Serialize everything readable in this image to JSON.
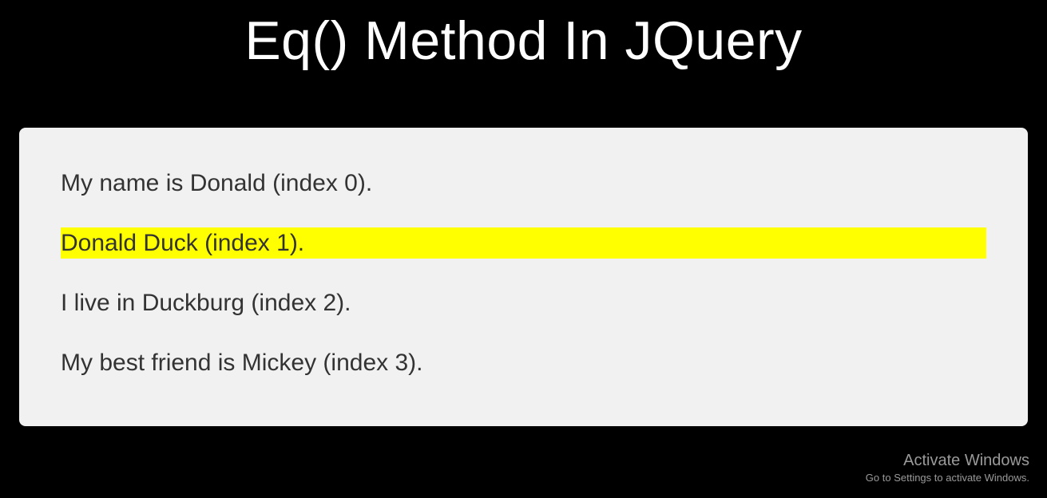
{
  "header": {
    "title": "Eq() Method In JQuery"
  },
  "content": {
    "items": [
      {
        "text": "My name is Donald (index 0).",
        "highlighted": false
      },
      {
        "text": "Donald Duck (index 1).",
        "highlighted": true
      },
      {
        "text": "I live in Duckburg (index 2).",
        "highlighted": false
      },
      {
        "text": "My best friend is Mickey (index 3).",
        "highlighted": false
      }
    ]
  },
  "watermark": {
    "title": "Activate Windows",
    "subtitle": "Go to Settings to activate Windows."
  },
  "colors": {
    "background": "#000000",
    "contentBox": "#f1f1f1",
    "highlight": "#ffff00",
    "titleText": "#ffffff",
    "bodyText": "#333333"
  }
}
